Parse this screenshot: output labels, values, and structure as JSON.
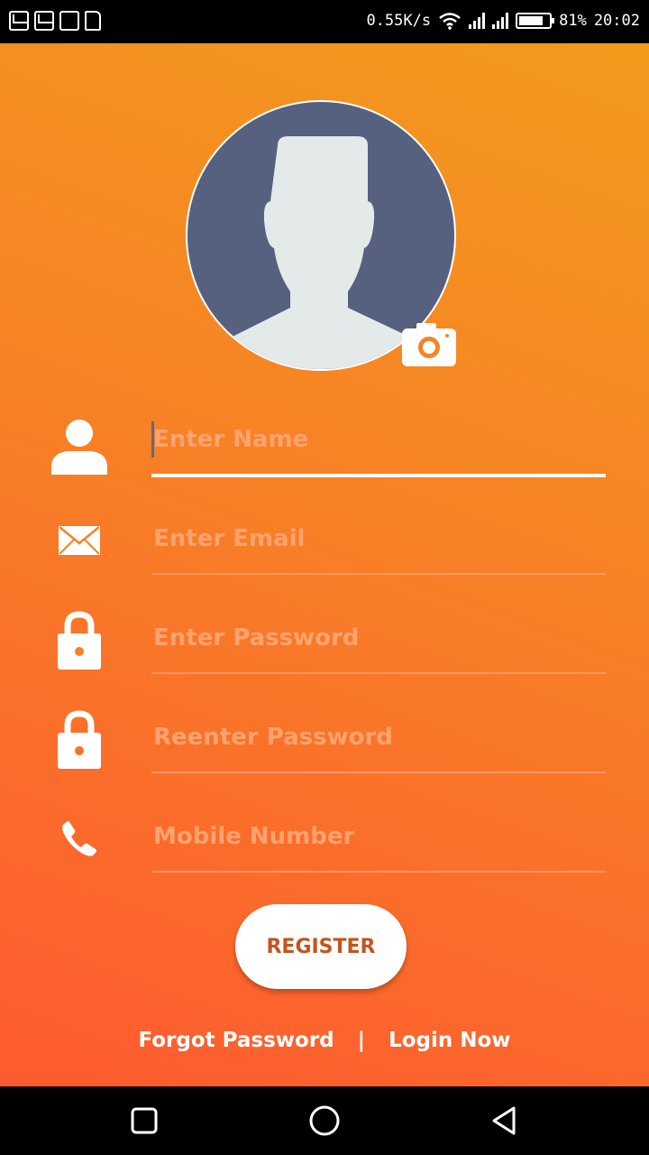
{
  "status_bar": {
    "speed": "0.55K/s",
    "battery": "81%",
    "time": "20:02",
    "battery_level": 0.81
  },
  "form": {
    "name_placeholder": "Enter Name",
    "email_placeholder": "Enter Email",
    "password_placeholder": "Enter Password",
    "reenter_placeholder": "Reenter Password",
    "mobile_placeholder": "Mobile Number"
  },
  "register_label": "REGISTER",
  "links": {
    "forgot": "Forgot Password",
    "separator": "|",
    "login": "Login Now"
  },
  "icons": {
    "user": "person-icon",
    "email": "envelope-icon",
    "password": "lock-icon",
    "mobile": "phone-icon",
    "camera": "camera-icon"
  },
  "colors": {
    "gradient_top": "#f39a1c",
    "gradient_bottom": "#fe5a2f",
    "avatar_bg": "#56607f",
    "button_text": "#c2551e"
  }
}
